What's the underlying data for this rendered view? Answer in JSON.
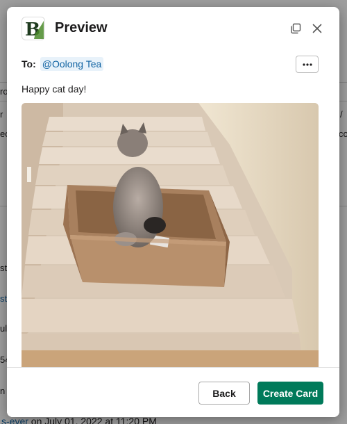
{
  "modal": {
    "title": "Preview",
    "app_logo_letter": "B",
    "to_label": "To:",
    "recipient": "@Oolong Tea",
    "message": "Happy cat day!",
    "gif_alt": "cat in cardboard box on stairs",
    "buttons": {
      "back": "Back",
      "create": "Create Card"
    },
    "colors": {
      "primary": "#007a5a",
      "mention_text": "#1264a3",
      "mention_bg": "#e8f2fa"
    },
    "icons": {
      "popout": "popout-icon",
      "close": "close-icon",
      "more": "more-horizontal-icon"
    }
  },
  "background": {
    "bottom_text_link": "s-ever",
    "bottom_text_rest": " on July 01, 2022 at 11:20 PM",
    "fragments": [
      "ro",
      "r",
      "eo",
      "st",
      "st",
      "ul",
      "54",
      "n",
      "/",
      "co"
    ]
  }
}
